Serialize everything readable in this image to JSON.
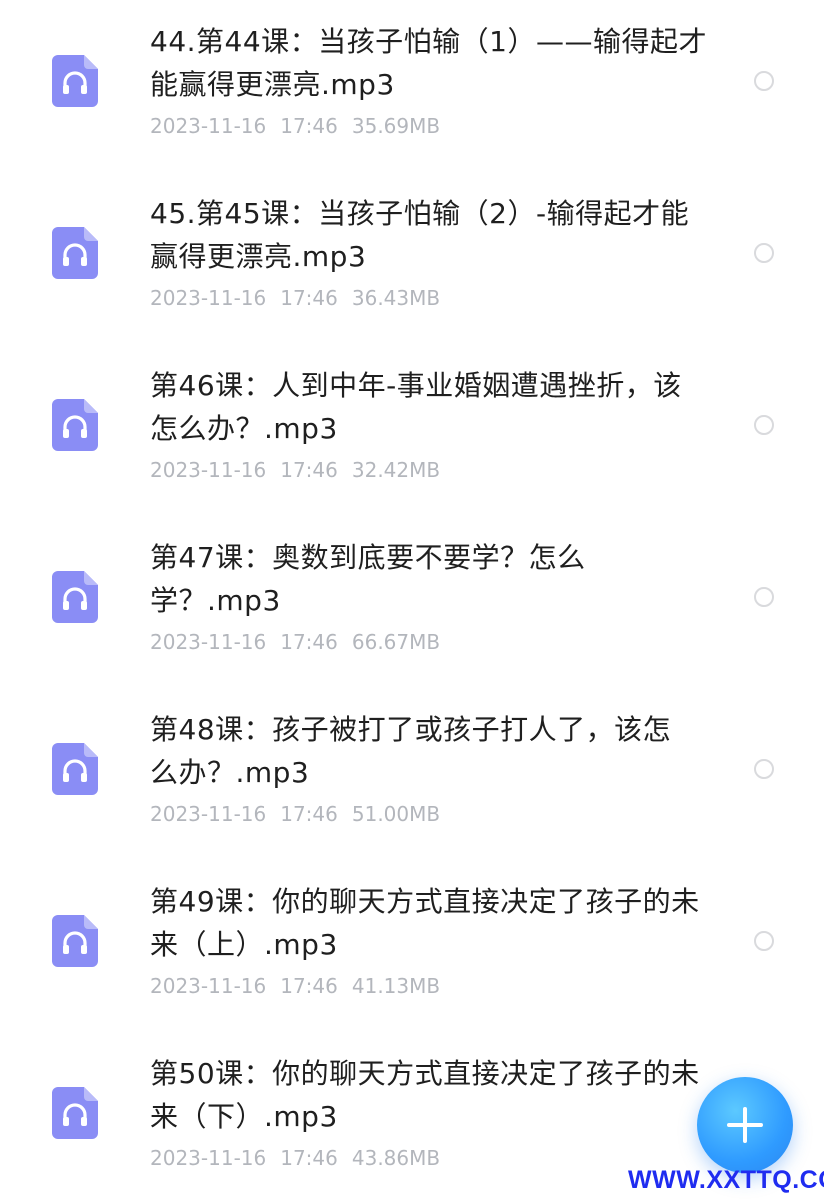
{
  "files": [
    {
      "title": "44.第44课：当孩子怕输（1）——输得起才能赢得更漂亮.mp3",
      "date": "2023-11-16",
      "time": "17:46",
      "size": "35.69MB"
    },
    {
      "title": "45.第45课：当孩子怕输（2）-输得起才能赢得更漂亮.mp3",
      "date": "2023-11-16",
      "time": "17:46",
      "size": "36.43MB"
    },
    {
      "title": "第46课：人到中年-事业婚姻遭遇挫折，该怎么办？.mp3",
      "date": "2023-11-16",
      "time": "17:46",
      "size": "32.42MB"
    },
    {
      "title": "第47课：奥数到底要不要学？怎么学？.mp3",
      "date": "2023-11-16",
      "time": "17:46",
      "size": "66.67MB"
    },
    {
      "title": "第48课：孩子被打了或孩子打人了，该怎么办？.mp3",
      "date": "2023-11-16",
      "time": "17:46",
      "size": "51.00MB"
    },
    {
      "title": "第49课：你的聊天方式直接决定了孩子的未来（上）.mp3",
      "date": "2023-11-16",
      "time": "17:46",
      "size": "41.13MB"
    },
    {
      "title": "第50课：你的聊天方式直接决定了孩子的未来（下）.mp3",
      "date": "2023-11-16",
      "time": "17:46",
      "size": "43.86MB"
    }
  ],
  "fab": {
    "icon": "plus-icon"
  },
  "watermark": "WWW.XXTTQ.COM",
  "colors": {
    "icon_accent": "#8a8df5",
    "fab": "#2f9bff",
    "meta_text": "#b3b6bc",
    "watermark": "#1f2cf0"
  }
}
